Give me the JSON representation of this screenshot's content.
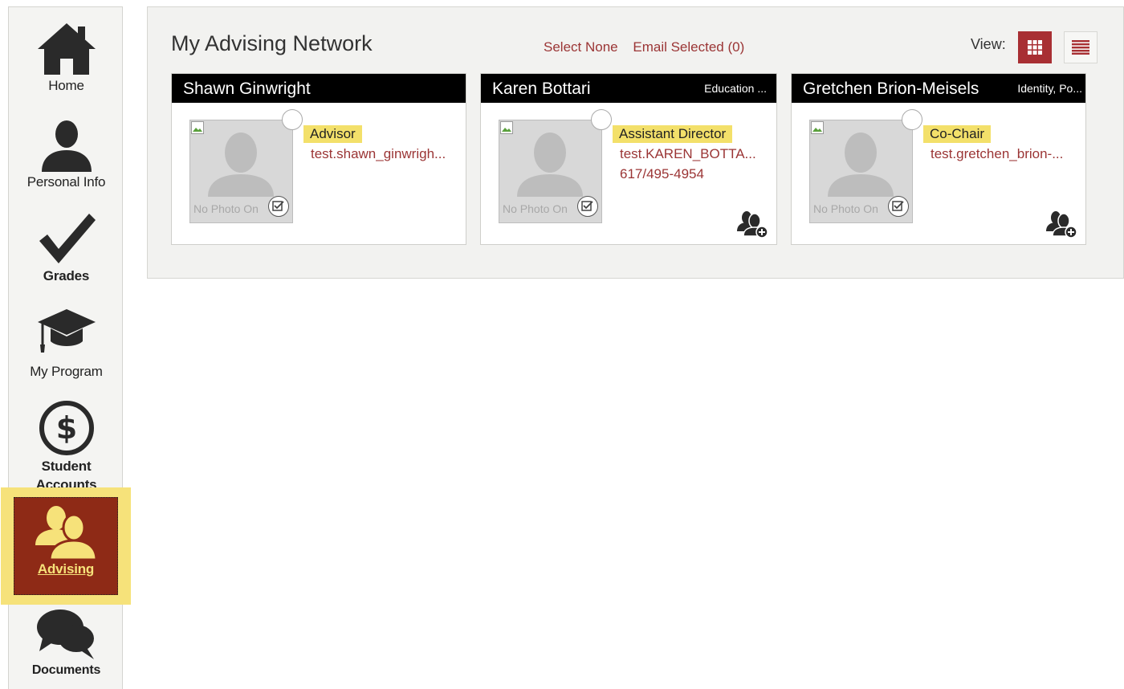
{
  "sidebar": {
    "items": [
      {
        "label": "Home",
        "icon": "house-icon"
      },
      {
        "label": "Personal Info",
        "icon": "person-icon"
      },
      {
        "label": "Grades",
        "icon": "checkmark-icon"
      },
      {
        "label": "My Program",
        "icon": "graduation-cap-icon"
      },
      {
        "label": "Student Accounts",
        "icon": "dollar-icon"
      },
      {
        "label": "Advising",
        "icon": "people-icon",
        "active": true
      },
      {
        "label": "Documents",
        "icon": "chat-bubbles-icon"
      }
    ],
    "active_bg": "#8e2a16",
    "highlight": "#f6e27a"
  },
  "panel": {
    "title": "My Advising Network",
    "select_none": "Select None",
    "email_selected": "Email Selected (0)",
    "view_label": "View:",
    "view_modes": [
      "grid-icon",
      "list-icon"
    ],
    "active_view": "grid"
  },
  "cards": [
    {
      "name": "Shawn Ginwright",
      "dept": "",
      "role": "Advisor",
      "email": "test.shawn_ginwrigh...",
      "phone": "",
      "photo_text": "No Photo On"
    },
    {
      "name": "Karen Bottari",
      "dept": "Education ...",
      "role": "Assistant Director",
      "email": "test.KAREN_BOTTA...",
      "phone": "617/495-4954",
      "photo_text": "No Photo On"
    },
    {
      "name": "Gretchen Brion-Meisels",
      "dept": "Identity, Po...",
      "role": "Co-Chair",
      "email": "test.gretchen_brion-...",
      "phone": "",
      "photo_text": "No Photo On"
    }
  ],
  "colors": {
    "accent": "#a82f33",
    "link": "#9b3535",
    "role_highlight": "#f3e06a"
  }
}
